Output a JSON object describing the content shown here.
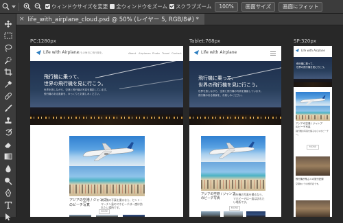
{
  "options_bar": {
    "resize_windows_label": "ウィンドウサイズを変更",
    "resize_windows_checked": true,
    "zoom_all_label": "全ウィンドウをズーム",
    "zoom_all_checked": false,
    "scrubby_zoom_label": "スクラブズーム",
    "scrubby_zoom_checked": true,
    "zoom_100_label": "100%",
    "fit_screen_label": "画面サイズ",
    "fill_screen_label": "画面にフィット"
  },
  "document_tab": {
    "close_label": "×",
    "title": "life_with_airplane_cloud.psd @ 50% (レイヤー 5, RGB/8#) *"
  },
  "tools": [
    "move-tool",
    "marquee-tool",
    "lasso-tool",
    "quick-select-tool",
    "crop-tool",
    "eyedropper-tool",
    "spot-healing-tool",
    "brush-tool",
    "clone-stamp-tool",
    "history-brush-tool",
    "eraser-tool",
    "gradient-tool",
    "blur-tool",
    "dodge-tool",
    "pen-tool",
    "type-tool",
    "path-select-tool"
  ],
  "artboards": {
    "pc": {
      "label": "PC:1280px",
      "site_title": "Life with Airplane",
      "tagline": "いつもの毎日に飛行機を。",
      "nav": [
        "About",
        "Airplanes",
        "Photo",
        "Travel",
        "Contact"
      ],
      "hero_title_line1": "飛行機に乗って、",
      "hero_title_line2": "世界の飛行機を見に行こう。",
      "hero_sub_line1": "世界を旅しながら、空港と飛行機の写真を撮影しています。",
      "hero_sub_line2": "飛行機のある風景を、ゆっくりとお楽しみください。",
      "article_title": "アジアの空港 / ジャンプ",
      "article_title2": "のビーチ写真",
      "article_date": "2018.06.12",
      "article_text": "飛行機の写真を撮るなら、セント・マーチン島のマホビーチは一度は訪れたい場所です。",
      "more_label": "MORE"
    },
    "tablet": {
      "label": "Tablet:768px",
      "site_title": "Life with Airplane",
      "hero_title_line1": "飛行機に乗って、",
      "hero_title_line2": "世界の飛行機を見に行こう。",
      "hero_sub_line1": "世界を旅しながら、空港と飛行機の写真を撮影しています。",
      "hero_sub_line2": "飛行機のある風景を、お楽しみください。",
      "article_title": "アジアの空港 / ジャンプ",
      "article_title2": "のビーチ写真",
      "article_text": "飛行機の写真を撮るなら、マホビーチは一度は訪れたい場所です。",
      "more_label": "MORE"
    },
    "sp": {
      "label": "SP:320px",
      "site_title": "Life with Airplane",
      "hero_title_line1": "飛行機に乗って、",
      "hero_title_line2": "世界の飛行機を見に行こう。",
      "article_title": "アジアの空港 / ジャンプ",
      "article_title2": "のビーチ写真",
      "article_text": "飛行機の写真を撮るならマホビーチへ。",
      "more_label": "MORE",
      "article2_title": "飛行機が飛ぶ人の旅行記録",
      "article2_text": "空港めぐりの旅行記です。"
    }
  },
  "colors": {
    "app_bg": "#282828",
    "panel": "#3c3c3c",
    "tab_active": "#535353",
    "accent": "#2f7fc1"
  }
}
